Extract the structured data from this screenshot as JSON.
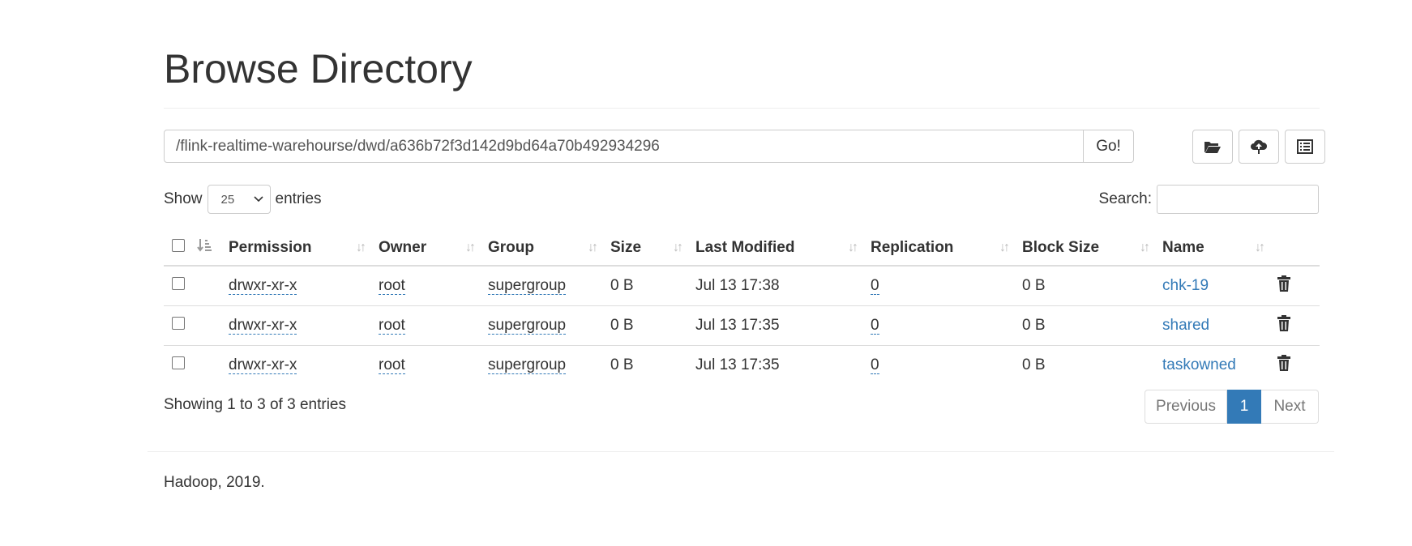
{
  "page_title": "Browse Directory",
  "path": {
    "value": "/flink-realtime-warehourse/dwd/a636b72f3d142d9bd64a70b492934296",
    "go_label": "Go!"
  },
  "toolbar": {
    "icons": [
      "folder-open-icon",
      "cloud-upload-icon",
      "list-alt-icon"
    ]
  },
  "length": {
    "show_label": "Show",
    "selected": "25",
    "entries_label": "entries"
  },
  "search": {
    "label": "Search:",
    "value": ""
  },
  "table": {
    "headers": [
      "Permission",
      "Owner",
      "Group",
      "Size",
      "Last Modified",
      "Replication",
      "Block Size",
      "Name"
    ],
    "rows": [
      {
        "permission": "drwxr-xr-x",
        "owner": "root",
        "group": "supergroup",
        "size": "0 B",
        "last_modified": "Jul 13 17:38",
        "replication": "0",
        "block_size": "0 B",
        "name": "chk-19"
      },
      {
        "permission": "drwxr-xr-x",
        "owner": "root",
        "group": "supergroup",
        "size": "0 B",
        "last_modified": "Jul 13 17:35",
        "replication": "0",
        "block_size": "0 B",
        "name": "shared"
      },
      {
        "permission": "drwxr-xr-x",
        "owner": "root",
        "group": "supergroup",
        "size": "0 B",
        "last_modified": "Jul 13 17:35",
        "replication": "0",
        "block_size": "0 B",
        "name": "taskowned"
      }
    ]
  },
  "info": "Showing 1 to 3 of 3 entries",
  "pagination": {
    "previous": "Previous",
    "current": "1",
    "next": "Next"
  },
  "footer": "Hadoop, 2019.",
  "colors": {
    "link": "#337ab7",
    "active_page": "#337ab7"
  }
}
